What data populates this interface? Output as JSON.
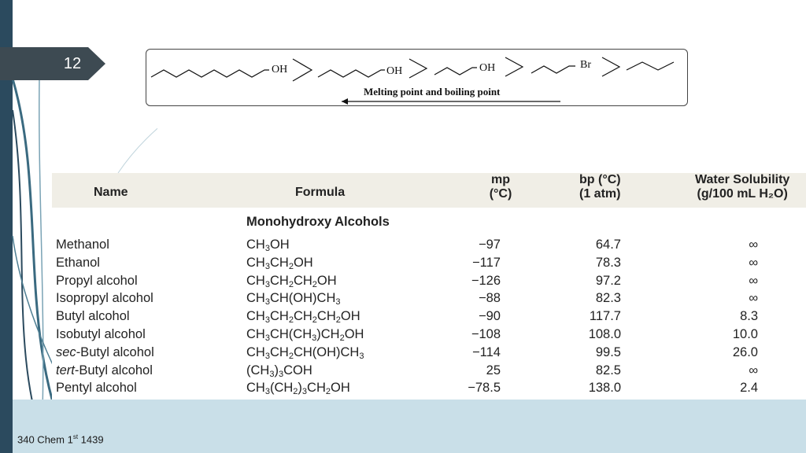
{
  "slide": {
    "number": "12",
    "footer": "340 Chem 1st 1439"
  },
  "molecules": {
    "labels": [
      "OH",
      "OH",
      "OH",
      "Br"
    ],
    "caption": "Melting point and boiling point"
  },
  "table": {
    "headers": {
      "name": "Name",
      "formula": "Formula",
      "mp": [
        "mp",
        "(°C)"
      ],
      "bp": [
        "bp (°C)",
        "(1 atm)"
      ],
      "sol": [
        "Water Solubility",
        "(g/100 mL H₂O)"
      ]
    },
    "section": "Monohydroxy Alcohols",
    "rows": [
      {
        "name": "Methanol",
        "formula": "CH₃OH",
        "mp": "−97",
        "bp": "64.7",
        "sol": "∞"
      },
      {
        "name": "Ethanol",
        "formula": "CH₃CH₂OH",
        "mp": "−117",
        "bp": "78.3",
        "sol": "∞"
      },
      {
        "name": "Propyl alcohol",
        "formula": "CH₃CH₂CH₂OH",
        "mp": "−126",
        "bp": "97.2",
        "sol": "∞"
      },
      {
        "name": "Isopropyl alcohol",
        "formula": "CH₃CH(OH)CH₃",
        "mp": "−88",
        "bp": "82.3",
        "sol": "∞"
      },
      {
        "name": "Butyl alcohol",
        "formula": "CH₃CH₂CH₂CH₂OH",
        "mp": "−90",
        "bp": "117.7",
        "sol": "8.3"
      },
      {
        "name": "Isobutyl alcohol",
        "formula": "CH₃CH(CH₃)CH₂OH",
        "mp": "−108",
        "bp": "108.0",
        "sol": "10.0"
      },
      {
        "name": "sec-Butyl alcohol",
        "formula": "CH₃CH₂CH(OH)CH₃",
        "mp": "−114",
        "bp": "99.5",
        "sol": "26.0"
      },
      {
        "name": "tert-Butyl alcohol",
        "formula": "(CH₃)₃COH",
        "mp": "25",
        "bp": "82.5",
        "sol": "∞"
      },
      {
        "name": "Pentyl alcohol",
        "formula": "CH₃(CH₂)₃CH₂OH",
        "mp": "−78.5",
        "bp": "138.0",
        "sol": "2.4"
      }
    ]
  }
}
